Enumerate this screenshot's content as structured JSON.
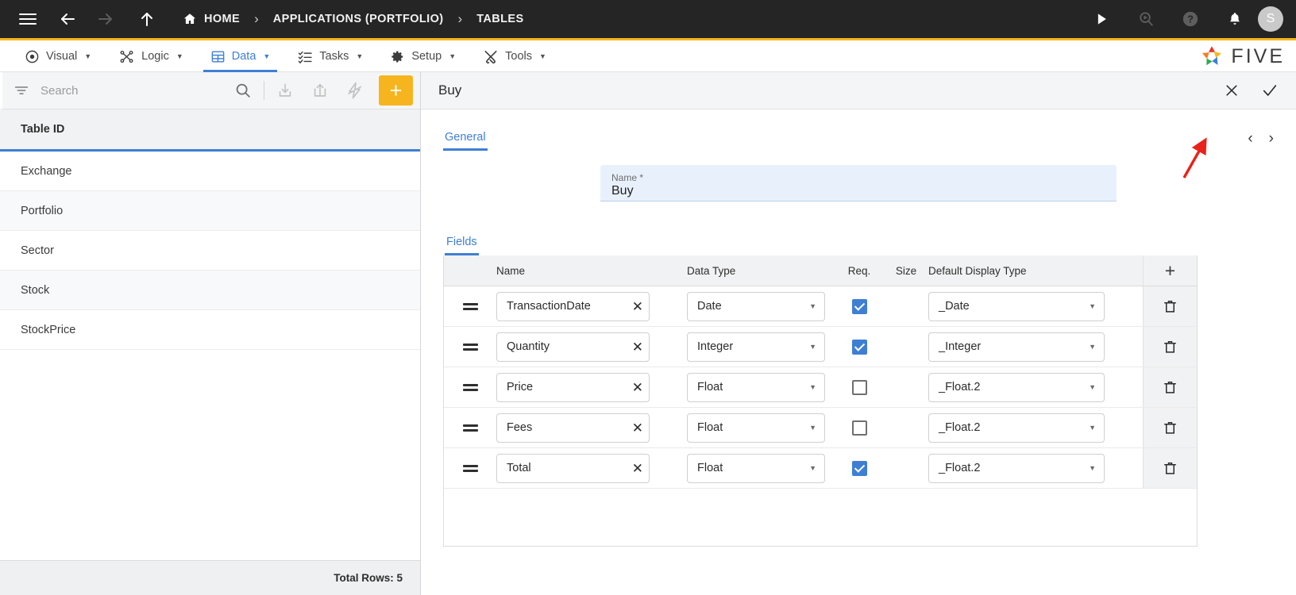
{
  "topbar": {
    "menu_icon": "hamburger-icon",
    "back_icon": "arrow-left-icon",
    "forward_icon": "arrow-right-icon",
    "up_icon": "arrow-up-icon",
    "breadcrumbs": [
      {
        "label": "HOME",
        "icon": "home-icon"
      },
      {
        "label": "APPLICATIONS (PORTFOLIO)",
        "icon": ""
      },
      {
        "label": "TABLES",
        "icon": ""
      }
    ],
    "separator": "›",
    "actions": [
      {
        "name": "run-icon",
        "glyph": "play"
      },
      {
        "name": "search-run-icon",
        "glyph": "search-play"
      },
      {
        "name": "help-icon",
        "glyph": "question"
      },
      {
        "name": "notifications-icon",
        "glyph": "bell"
      }
    ],
    "avatar_initial": "S",
    "bg_color": "#252525"
  },
  "menubar": {
    "accent_bar_color": "#f5b71d",
    "active_color": "#3e7fd4",
    "items": [
      {
        "label": "Visual",
        "icon": "eye-icon",
        "active": false
      },
      {
        "label": "Logic",
        "icon": "logic-nodes-icon",
        "active": false
      },
      {
        "label": "Data",
        "icon": "table-grid-icon",
        "active": true
      },
      {
        "label": "Tasks",
        "icon": "checklist-icon",
        "active": false
      },
      {
        "label": "Setup",
        "icon": "gear-icon",
        "active": false
      },
      {
        "label": "Tools",
        "icon": "tools-icon",
        "active": false
      }
    ],
    "caret": "▼",
    "brand": {
      "text": "FIVE",
      "icon": "five-star-logo-icon"
    }
  },
  "sidebar": {
    "search": {
      "placeholder": "Search",
      "value": ""
    },
    "toolbar": [
      {
        "name": "filter-icon"
      },
      {
        "name": "search-icon"
      },
      {
        "name": "import-icon"
      },
      {
        "name": "export-icon"
      },
      {
        "name": "flash-icon"
      },
      {
        "name": "add-button",
        "label": "+"
      }
    ],
    "column_header": "Table ID",
    "rows": [
      {
        "label": "Exchange"
      },
      {
        "label": "Portfolio"
      },
      {
        "label": "Sector"
      },
      {
        "label": "Stock"
      },
      {
        "label": "StockPrice"
      }
    ],
    "footer": "Total Rows: 5"
  },
  "record": {
    "title": "Buy",
    "close_label": "✕",
    "confirm_label": "✓",
    "tabs": [
      {
        "label": "General",
        "selected": true
      }
    ],
    "pager": {
      "prev": "‹",
      "next": "›"
    },
    "name_field": {
      "label": "Name *",
      "value": "Buy",
      "placeholder": ""
    },
    "fields_tab": {
      "label": "Fields",
      "selected": true
    },
    "fields_table": {
      "columns": [
        "",
        "Name",
        "Data Type",
        "Req.",
        "Size",
        "Default Display Type",
        "+"
      ],
      "add_row_label": "+",
      "delete_icon": "trash-icon",
      "drag_icon": "drag-handle-icon",
      "clear_icon": "clear-x-icon",
      "dropdown_icon": "chevron-down-icon",
      "rows": [
        {
          "name": "TransactionDate",
          "data_type": "Date",
          "required": true,
          "size": "",
          "display_type": "_Date"
        },
        {
          "name": "Quantity",
          "data_type": "Integer",
          "required": true,
          "size": "",
          "display_type": "_Integer"
        },
        {
          "name": "Price",
          "data_type": "Float",
          "required": false,
          "size": "",
          "display_type": "_Float.2"
        },
        {
          "name": "Fees",
          "data_type": "Float",
          "required": false,
          "size": "",
          "display_type": "_Float.2"
        },
        {
          "name": "Total",
          "data_type": "Float",
          "required": true,
          "size": "",
          "display_type": "_Float.2"
        }
      ]
    }
  },
  "annotation": {
    "name": "red-arrow-pointing-to-next-page-button",
    "color": "#e8221a"
  }
}
